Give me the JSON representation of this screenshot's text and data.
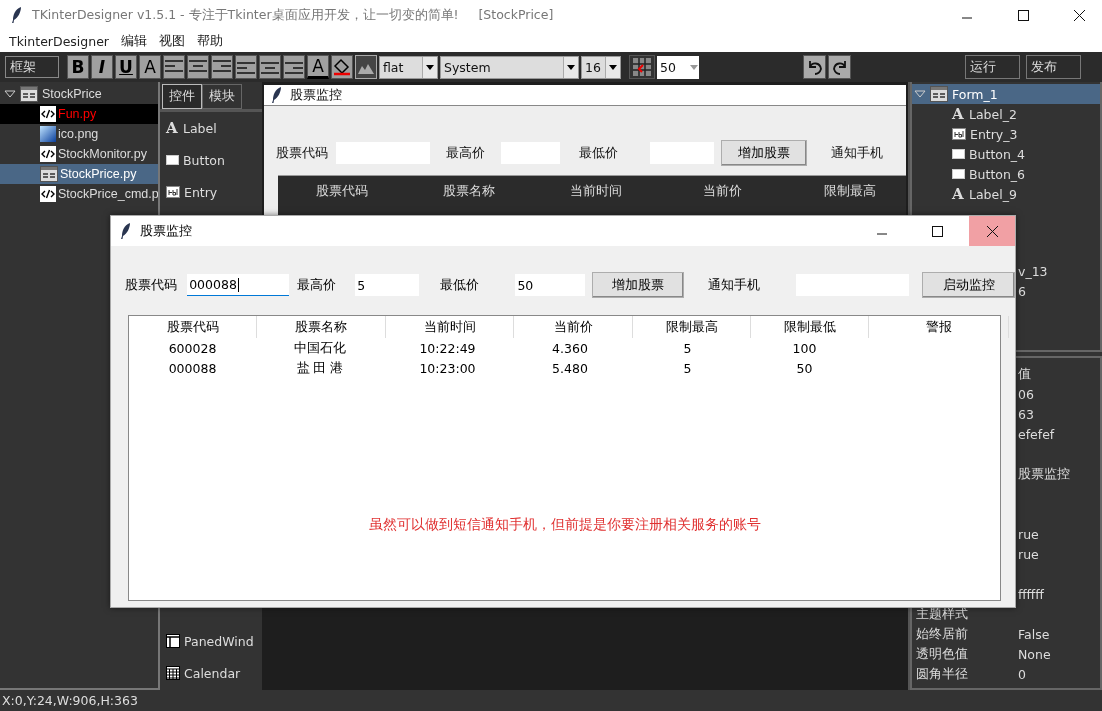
{
  "window": {
    "title": "TKinterDesigner v1.5.1 - 专注于Tkinter桌面应用开发，让一切变的简单!     [StockPrice]"
  },
  "menu": [
    "TkinterDesigner",
    "编辑",
    "视图",
    "帮助"
  ],
  "toolbar": {
    "frame_selector": "框架",
    "format_buttons": [
      "B",
      "I",
      "U",
      "A"
    ],
    "color_glyph": "A",
    "relief": "flat",
    "font": "System",
    "size": "16",
    "grid_size": "50",
    "run": "运行",
    "publish": "发布"
  },
  "project_tree": {
    "root": "StockPrice",
    "expanded": true,
    "files": [
      {
        "name": "Fun.py",
        "kind": "code",
        "active": true,
        "selected": false
      },
      {
        "name": "ico.png",
        "kind": "image",
        "active": false,
        "selected": false
      },
      {
        "name": "StockMonitor.py",
        "kind": "code",
        "active": false,
        "selected": false
      },
      {
        "name": "StockPrice.py",
        "kind": "window",
        "active": false,
        "selected": true
      },
      {
        "name": "StockPrice_cmd.p",
        "kind": "code",
        "active": false,
        "selected": false
      }
    ]
  },
  "palette": {
    "tabs": [
      {
        "label": "控件",
        "selected": true
      },
      {
        "label": "模块",
        "selected": false
      }
    ],
    "items": [
      {
        "label": "Label",
        "kind": "label",
        "glyph": "A"
      },
      {
        "label": "Button",
        "kind": "button"
      },
      {
        "label": "Entry",
        "kind": "entry"
      }
    ],
    "lower_items": [
      {
        "label": "PanedWind",
        "kind": "paned"
      },
      {
        "label": "Calendar",
        "kind": "calendar"
      }
    ]
  },
  "preview": {
    "title": "股票监控",
    "fields": [
      {
        "kind": "label",
        "text": "股票代码"
      },
      {
        "kind": "entry"
      },
      {
        "kind": "label",
        "text": "最高价"
      },
      {
        "kind": "entry"
      },
      {
        "kind": "label",
        "text": "最低价"
      },
      {
        "kind": "entry"
      },
      {
        "kind": "button",
        "text": "增加股票"
      },
      {
        "kind": "label",
        "text": "通知手机"
      }
    ],
    "columns": [
      "股票代码",
      "股票名称",
      "当前时间",
      "当前价",
      "限制最高"
    ]
  },
  "widget_tree": {
    "root": "Form_1",
    "expanded": true,
    "selected": true,
    "children": [
      {
        "label": "Label_2",
        "kind": "label",
        "glyph": "A"
      },
      {
        "label": "Entry_3",
        "kind": "entry"
      },
      {
        "label": "Button_4",
        "kind": "button"
      },
      {
        "label": "Button_6",
        "kind": "button"
      },
      {
        "label": "Label_9",
        "kind": "label",
        "glyph": "A"
      }
    ],
    "fragments": [
      "v_13",
      "6"
    ]
  },
  "properties": {
    "value_header": "值",
    "rows": [
      {
        "value": "06"
      },
      {
        "value": "63"
      },
      {
        "value": "efefef"
      },
      {},
      {
        "value": "股票监控"
      },
      {},
      {},
      {
        "value": "rue"
      },
      {
        "value": "rue"
      },
      {},
      {
        "value": "ffffff"
      },
      {
        "key": "主题样式"
      },
      {
        "key": "始终居前",
        "value": "False"
      },
      {
        "key": "透明色值",
        "value": "None"
      },
      {
        "key": "圆角半径",
        "value": "0"
      }
    ]
  },
  "status_bar": "X:0,Y:24,W:906,H:363",
  "dialog": {
    "title": "股票监控",
    "fields": [
      {
        "kind": "label",
        "text": "股票代码"
      },
      {
        "kind": "entry",
        "value": "000088",
        "focused": true
      },
      {
        "kind": "label",
        "text": "最高价"
      },
      {
        "kind": "entry",
        "value": "5"
      },
      {
        "kind": "label",
        "text": "最低价"
      },
      {
        "kind": "entry",
        "value": "50"
      },
      {
        "kind": "button",
        "text": "增加股票"
      },
      {
        "kind": "label",
        "text": "通知手机"
      },
      {
        "kind": "entry"
      },
      {
        "kind": "button",
        "text": "启动监控"
      }
    ],
    "table": {
      "columns": [
        "股票代码",
        "股票名称",
        "当前时间",
        "当前价",
        "限制最高",
        "限制最低",
        "警报"
      ],
      "rows": [
        [
          "600028",
          "中国石化",
          "10:22:49",
          "4.360",
          "5",
          "100"
        ],
        [
          "000088",
          "盐 田 港",
          "10:23:00",
          "5.480",
          "5",
          "50"
        ]
      ]
    },
    "message": "虽然可以做到短信通知手机，但前提是你要注册相关服务的账号"
  }
}
